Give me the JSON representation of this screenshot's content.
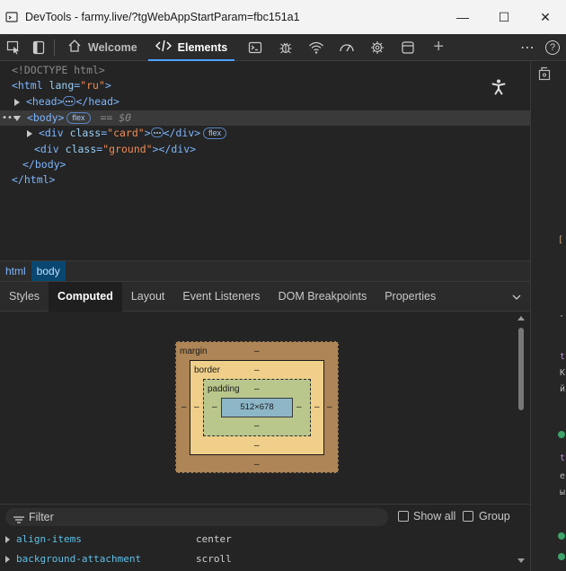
{
  "window": {
    "title": "DevTools - farmy.live/?tgWebAppStartParam=fbc151a1",
    "minimize": "—",
    "maximize": "☐",
    "close": "✕"
  },
  "toolbar": {
    "tabs": [
      {
        "label": "Welcome",
        "icon": "home-icon"
      },
      {
        "label": "Elements",
        "icon": "code-icon",
        "active": true
      }
    ],
    "add": "+",
    "more": "⋯",
    "help": "?"
  },
  "dom": {
    "doctype": "<!DOCTYPE html>",
    "html_open_tag": "<html",
    "html_attr": "lang",
    "html_attr_val": "\"ru\"",
    "head_open": "<head>",
    "head_close": "</head>",
    "body_open": "<body>",
    "body_badge": "flex",
    "body_eq": "== $0",
    "div1_open": "<div",
    "div1_attr": "class",
    "div1_val": "\"card\"",
    "div1_close": "</div>",
    "div1_badge": "flex",
    "div2_open": "<div",
    "div2_attr": "class",
    "div2_val": "\"ground\"",
    "div2_close": "></div>",
    "body_close": "</body>",
    "html_close": "</html>"
  },
  "breadcrumbs": [
    {
      "label": "html",
      "active": false
    },
    {
      "label": "body",
      "active": true
    }
  ],
  "panel_tabs": [
    {
      "label": "Styles",
      "active": false
    },
    {
      "label": "Computed",
      "active": true
    },
    {
      "label": "Layout",
      "active": false
    },
    {
      "label": "Event Listeners",
      "active": false
    },
    {
      "label": "DOM Breakpoints",
      "active": false
    },
    {
      "label": "Properties",
      "active": false
    }
  ],
  "boxmodel": {
    "margin_label": "margin",
    "border_label": "border",
    "padding_label": "padding",
    "content_size": "512×678",
    "dash": "–"
  },
  "filter": {
    "placeholder": "Filter",
    "show_all": "Show all",
    "group": "Group"
  },
  "properties": [
    {
      "name": "align-items",
      "value": "center"
    },
    {
      "name": "background-attachment",
      "value": "scroll"
    }
  ],
  "colors": {
    "accent": "#4aa3ff",
    "margin": "#ad8556",
    "border": "#f0cf8a",
    "padding": "#b9c78c",
    "content": "#8db6c7"
  }
}
